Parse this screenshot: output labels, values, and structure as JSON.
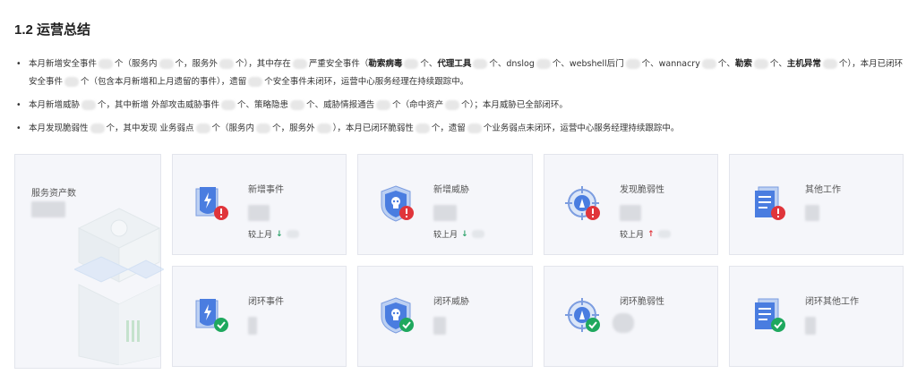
{
  "section": {
    "title": "1.2 运营总结"
  },
  "summary": {
    "p1": {
      "t1": "本月新增安全事件",
      "t2": "个（服务内",
      "t3": "个，服务外",
      "t4": "个），其中存在",
      "t5": "严重安全事件（",
      "k1": "勒索病毒",
      "t6": "个、",
      "k2": "代理工具",
      "t7": "个、dnslog",
      "t8": "个、webshell后门",
      "t9": "个、wannacry",
      "t10": "个、",
      "k3": "勒索",
      "t11": "个、",
      "k4": "主机异常",
      "t12": "个），本月已闭环安全事件",
      "t13": "个（包含本月新增和上月遗留的事件），遗留",
      "t14": "个安全事件未闭环，运营中心服务经理在持续跟踪中。"
    },
    "p2": {
      "t1": "本月新增威胁",
      "t2": "个，其中新增 外部攻击威胁事件",
      "t3": "个、策略隐患",
      "t4": "个、威胁情报通告",
      "t5": "个（命中资产",
      "t6": "个）；本月威胁已全部闭环。"
    },
    "p3": {
      "t1": "本月发现脆弱性",
      "t2": "个，其中发现 业务弱点",
      "t3": "个（服务内",
      "t4": "个，服务外",
      "t5": "），本月已闭环脆弱性",
      "t6": "个，遗留",
      "t7": "个业务弱点未闭环，运营中心服务经理持续跟踪中。"
    }
  },
  "cards": {
    "assets": {
      "label": "服务资产数"
    },
    "new_events": {
      "label": "新增事件",
      "trend_label": "较上月",
      "trend": "down",
      "icon": "shield-event-icon",
      "status_icon": "alert-icon"
    },
    "new_threats": {
      "label": "新增威胁",
      "trend_label": "较上月",
      "trend": "down",
      "icon": "shield-threat-icon",
      "status_icon": "alert-icon"
    },
    "vulns": {
      "label": "发现脆弱性",
      "trend_label": "较上月",
      "trend": "up",
      "icon": "target-vuln-icon",
      "status_icon": "alert-icon"
    },
    "other_work": {
      "label": "其他工作",
      "icon": "document-icon",
      "status_icon": "alert-icon"
    },
    "closed_events": {
      "label": "闭环事件",
      "icon": "shield-event-icon",
      "status_icon": "check-icon"
    },
    "closed_threats": {
      "label": "闭环威胁",
      "icon": "shield-threat-icon",
      "status_icon": "check-icon"
    },
    "closed_vulns": {
      "label": "闭环脆弱性",
      "icon": "target-vuln-icon",
      "status_icon": "check-icon"
    },
    "closed_other": {
      "label": "闭环其他工作",
      "icon": "document-icon",
      "status_icon": "check-icon"
    }
  },
  "colors": {
    "alert": "#e0353b",
    "ok": "#1fa85e",
    "icon_blue": "#4a7de0",
    "arrow_down": "#2ea36b",
    "arrow_up": "#e0353b"
  }
}
